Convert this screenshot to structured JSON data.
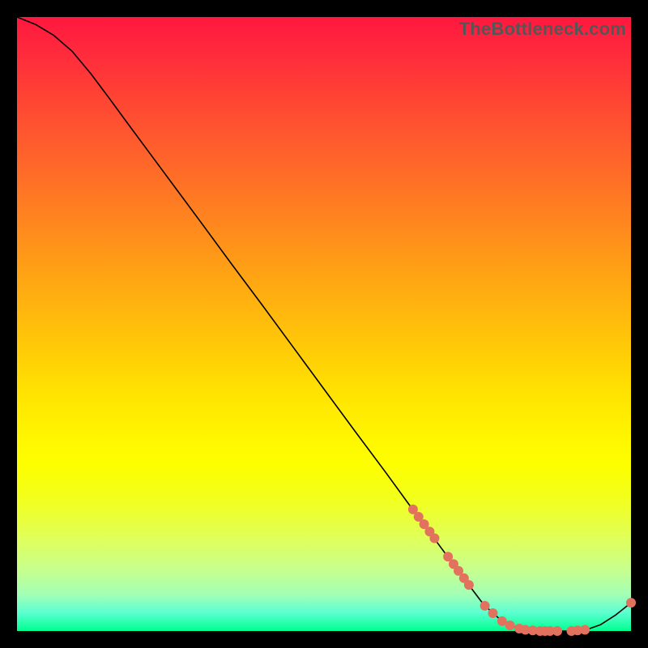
{
  "watermark": "TheBottleneck.com",
  "chart_data": {
    "type": "line",
    "title": "",
    "xlabel": "",
    "ylabel": "",
    "xlim": [
      0,
      100
    ],
    "ylim": [
      0,
      100
    ],
    "grid": false,
    "curve": [
      {
        "x": 0.0,
        "y": 100.0
      },
      {
        "x": 3.0,
        "y": 98.8
      },
      {
        "x": 6.0,
        "y": 97.0
      },
      {
        "x": 9.0,
        "y": 94.4
      },
      {
        "x": 12.0,
        "y": 90.8
      },
      {
        "x": 15.0,
        "y": 86.8
      },
      {
        "x": 18.0,
        "y": 82.7
      },
      {
        "x": 22.0,
        "y": 77.3
      },
      {
        "x": 26.0,
        "y": 71.9
      },
      {
        "x": 30.0,
        "y": 66.5
      },
      {
        "x": 35.0,
        "y": 59.7
      },
      {
        "x": 40.0,
        "y": 53.0
      },
      {
        "x": 45.0,
        "y": 46.2
      },
      {
        "x": 50.0,
        "y": 39.4
      },
      {
        "x": 55.0,
        "y": 32.6
      },
      {
        "x": 60.0,
        "y": 25.9
      },
      {
        "x": 64.0,
        "y": 20.4
      },
      {
        "x": 68.0,
        "y": 15.0
      },
      {
        "x": 72.0,
        "y": 9.6
      },
      {
        "x": 76.0,
        "y": 4.3
      },
      {
        "x": 79.0,
        "y": 1.6
      },
      {
        "x": 82.0,
        "y": 0.3
      },
      {
        "x": 85.0,
        "y": 0.0
      },
      {
        "x": 88.0,
        "y": 0.0
      },
      {
        "x": 91.0,
        "y": 0.0
      },
      {
        "x": 93.0,
        "y": 0.3
      },
      {
        "x": 95.0,
        "y": 1.0
      },
      {
        "x": 97.5,
        "y": 2.6
      },
      {
        "x": 100.0,
        "y": 4.6
      }
    ],
    "markers": [
      {
        "x": 64.5,
        "y": 19.8
      },
      {
        "x": 65.4,
        "y": 18.6
      },
      {
        "x": 66.3,
        "y": 17.4
      },
      {
        "x": 67.2,
        "y": 16.2
      },
      {
        "x": 68.0,
        "y": 15.1
      },
      {
        "x": 70.2,
        "y": 12.1
      },
      {
        "x": 71.1,
        "y": 10.9
      },
      {
        "x": 71.9,
        "y": 9.8
      },
      {
        "x": 72.8,
        "y": 8.6
      },
      {
        "x": 73.6,
        "y": 7.5
      },
      {
        "x": 76.2,
        "y": 4.1
      },
      {
        "x": 77.5,
        "y": 2.9
      },
      {
        "x": 79.0,
        "y": 1.6
      },
      {
        "x": 80.3,
        "y": 0.9
      },
      {
        "x": 81.8,
        "y": 0.4
      },
      {
        "x": 82.8,
        "y": 0.2
      },
      {
        "x": 84.0,
        "y": 0.1
      },
      {
        "x": 85.2,
        "y": 0.0
      },
      {
        "x": 86.0,
        "y": 0.0
      },
      {
        "x": 86.8,
        "y": 0.0
      },
      {
        "x": 88.0,
        "y": 0.0
      },
      {
        "x": 90.3,
        "y": 0.0
      },
      {
        "x": 91.3,
        "y": 0.1
      },
      {
        "x": 92.5,
        "y": 0.2
      },
      {
        "x": 100.0,
        "y": 4.6
      }
    ],
    "marker_color": "#e2725e",
    "marker_radius_px": 6
  }
}
